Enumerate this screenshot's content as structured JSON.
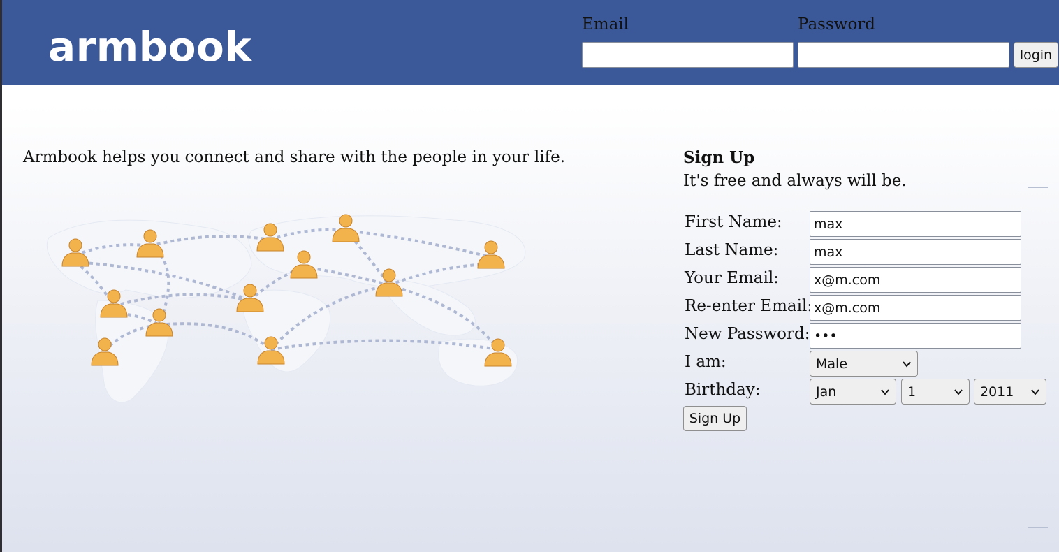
{
  "header": {
    "logo": "armbook",
    "email_label": "Email",
    "password_label": "Password",
    "email_value": "",
    "password_value": "",
    "login_label": "login",
    "background_color": "#3b5998"
  },
  "main": {
    "tagline": "Armbook helps you connect and share with the people in your life.",
    "map_icon": "world-map-people-icon"
  },
  "signup": {
    "title": "Sign Up",
    "subtitle": "It's free and always will be.",
    "first_name_label": "First Name:",
    "first_name_value": "max",
    "last_name_label": "Last Name:",
    "last_name_value": "max",
    "email_label": "Your Email:",
    "email_value": "x@m.com",
    "reemail_label": "Re-enter Email:",
    "reemail_value": "x@m.com",
    "password_label": "New Password:",
    "password_value": "•••",
    "gender_label": "I am:",
    "gender_value": "Male",
    "birthday_label": "Birthday:",
    "birthday_month": "Jan",
    "birthday_day": "1",
    "birthday_year": "2011",
    "button_label": "Sign Up"
  }
}
